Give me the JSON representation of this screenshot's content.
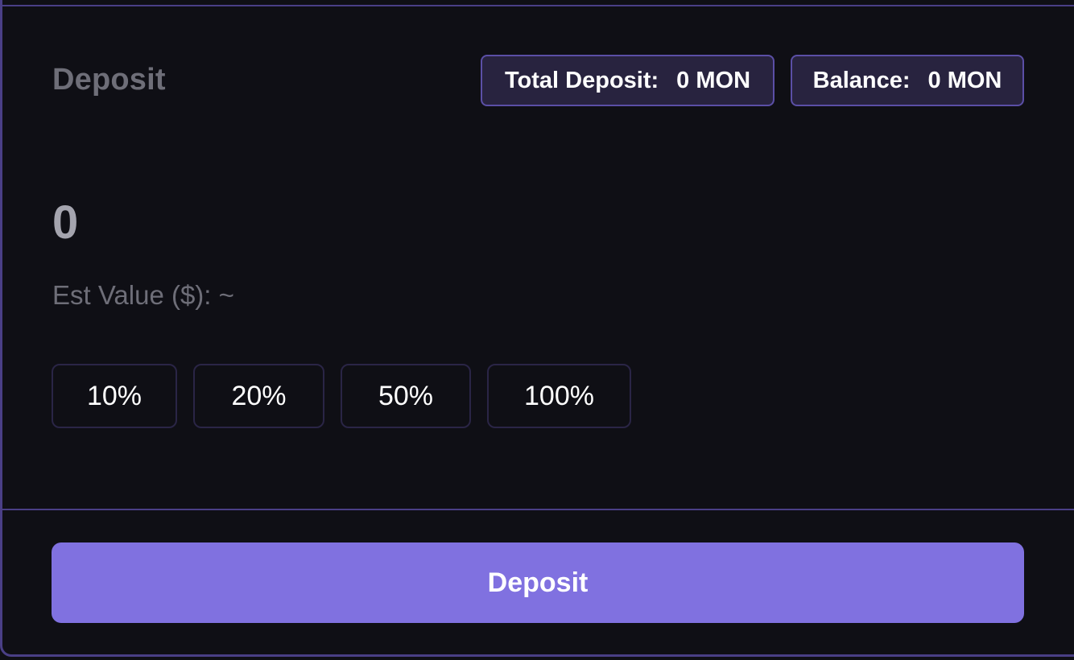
{
  "header": {
    "title": "Deposit",
    "total_deposit_label": "Total Deposit:",
    "total_deposit_value": "0 MON",
    "balance_label": "Balance:",
    "balance_value": "0 MON"
  },
  "amount": {
    "value": "0"
  },
  "est_value_label": "Est Value ($): ~",
  "percent_buttons": [
    "10%",
    "20%",
    "50%",
    "100%"
  ],
  "submit": {
    "label": "Deposit"
  },
  "colors": {
    "background": "#0f0f15",
    "border_accent": "#4a3f86",
    "pill_background": "#28233f",
    "primary_button": "#8071e0"
  }
}
